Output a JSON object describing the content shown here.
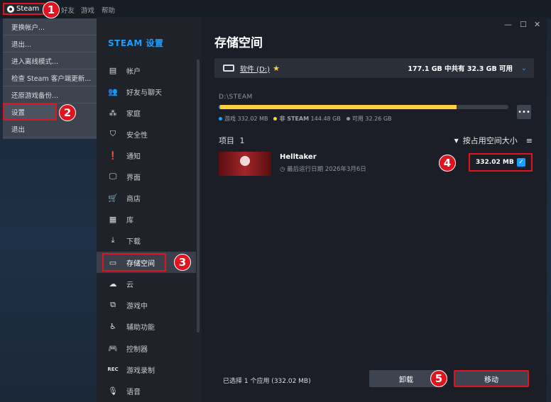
{
  "topbar": {
    "steam_label": "Steam",
    "menus": [
      "好友",
      "游戏",
      "帮助"
    ]
  },
  "dropdown": {
    "items": [
      "更换帐户...",
      "退出...",
      "进入离线模式...",
      "检查 Steam 客户端更新...",
      "还原游戏备份...",
      "设置",
      "退出"
    ]
  },
  "sidebar": {
    "title": "STEAM 设置",
    "items": [
      {
        "label": "帐户",
        "icon": "account-icon"
      },
      {
        "label": "好友与聊天",
        "icon": "friends-icon"
      },
      {
        "label": "家庭",
        "icon": "family-icon"
      },
      {
        "label": "安全性",
        "icon": "shield-icon"
      },
      {
        "label": "通知",
        "icon": "notification-icon"
      },
      {
        "label": "界面",
        "icon": "monitor-icon"
      },
      {
        "label": "商店",
        "icon": "cart-icon"
      },
      {
        "label": "库",
        "icon": "grid-icon"
      },
      {
        "label": "下载",
        "icon": "download-icon"
      },
      {
        "label": "存储空间",
        "icon": "drive-icon"
      },
      {
        "label": "云",
        "icon": "cloud-icon"
      },
      {
        "label": "游戏中",
        "icon": "ingame-icon"
      },
      {
        "label": "辅助功能",
        "icon": "accessibility-icon"
      },
      {
        "label": "控制器",
        "icon": "controller-icon"
      },
      {
        "label": "游戏录制",
        "icon": "rec-icon"
      },
      {
        "label": "语音",
        "icon": "mic-icon"
      }
    ]
  },
  "main": {
    "title": "存储空间",
    "drive_name": "软件 (D:)",
    "drive_space": "177.1 GB 中共有 32.3 GB 可用",
    "path": "D:\\STEAM",
    "usage": {
      "game_gb": 0.33,
      "other_gb": 144.48,
      "free_gb": 32.26,
      "total_gb": 177.1
    },
    "legend": {
      "game": "游戏 332.02 MB",
      "non_steam_label": "非 STEAM",
      "non_steam_value": "144.48 GB",
      "free": "可用 32.26 GB"
    },
    "items_label": "项目",
    "items_count": "1",
    "sort_label": "按占用空间大小",
    "game": {
      "name": "Helltaker",
      "last_played": "最后运行日期 2026年3月6日",
      "size": "332.02 MB",
      "checked": true
    },
    "footer_selection": "已选择 1 个应用 (332.02 MB)",
    "uninstall_label": "卸载",
    "move_label": "移动"
  },
  "colors": {
    "accent": "#1a9fff",
    "warning": "#ffcf3f",
    "highlight": "#e0141e"
  },
  "badges": [
    "1",
    "2",
    "3",
    "4",
    "5"
  ]
}
